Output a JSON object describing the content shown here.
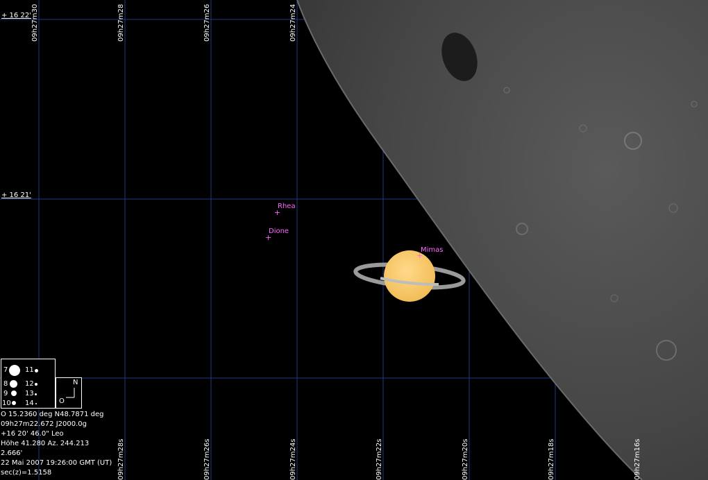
{
  "dec_labels": [
    "+ 16 22'",
    "+ 16 21'"
  ],
  "ra_top_labels": [
    "09h27m30",
    "09h27m28",
    "09h27m26",
    "09h27m24"
  ],
  "ra_bottom_labels": [
    "09h27m28s",
    "09h27m26s",
    "09h27m24s",
    "09h27m22s",
    "09h27m20s",
    "09h27m18s",
    "09h27m16s"
  ],
  "moons": {
    "rhea": "Rhea",
    "dione": "Dione",
    "mimas": "Mimas"
  },
  "legend": {
    "magnitudes": [
      "7",
      "8",
      "9",
      "10",
      "11",
      "12",
      "13",
      "14"
    ],
    "compass_n": "N",
    "compass_o": "O"
  },
  "info": {
    "line1": "O 15.2360 deg N48.7871 deg",
    "line2": "09h27m22.672 J2000.0g",
    "line3": "+16 20' 46.0\"    Leo",
    "line4": "Höhe 41.280  Az. 244.213",
    "line5": "2.666'",
    "line6": "22 Mai 2007 19:26:00 GMT (UT)",
    "line7": "sec(z)=1.5158"
  },
  "colors": {
    "grid": "#1e3a8a",
    "moon_labels": "#ff66ff",
    "saturn": "#f7c96a",
    "lunar_surface": "#4a4a4a"
  }
}
